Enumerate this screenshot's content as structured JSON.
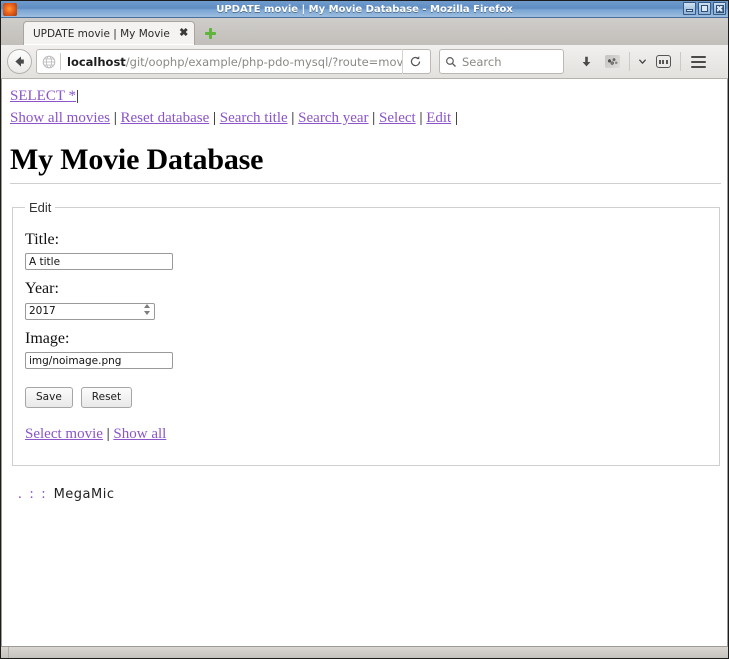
{
  "window": {
    "title": "UPDATE movie | My Movie Database - Mozilla Firefox",
    "app_icon": "firefox-icon",
    "controls": {
      "minimize": "minimize-button",
      "maximize": "maximize-button",
      "close": "close-button"
    }
  },
  "browser": {
    "tab": {
      "label": "UPDATE movie | My Movie D...",
      "close_label": "✖"
    },
    "new_tab_label": "new-tab",
    "back_label": "Back",
    "url": {
      "host": "localhost",
      "path": "/git/oophp/example/php-pdo-mysql/?route=movie-edit&"
    },
    "reload_label": "↻",
    "search": {
      "placeholder": "Search",
      "value": ""
    },
    "tools": {
      "downloads": "downloads",
      "addon": "addon",
      "chevron": "⌄",
      "reader": "reader-view",
      "menu": "open-menu"
    }
  },
  "page": {
    "top_nav": {
      "first_row": [
        {
          "label": "SELECT *",
          "href": "#"
        }
      ],
      "second_row": [
        {
          "label": "Show all movies",
          "href": "#"
        },
        {
          "label": "Reset database",
          "href": "#"
        },
        {
          "label": "Search title",
          "href": "#"
        },
        {
          "label": "Search year",
          "href": "#"
        },
        {
          "label": "Select",
          "href": "#"
        },
        {
          "label": "Edit",
          "href": "#"
        }
      ],
      "separator": "|"
    },
    "title": "My Movie Database",
    "form": {
      "legend": "Edit",
      "fields": [
        {
          "name": "title",
          "label": "Title:",
          "value": "A title",
          "type": "text"
        },
        {
          "name": "year",
          "label": "Year:",
          "value": "2017",
          "type": "number"
        },
        {
          "name": "image",
          "label": "Image:",
          "value": "img/noimage.png",
          "type": "text"
        }
      ],
      "buttons": [
        {
          "name": "save",
          "label": "Save"
        },
        {
          "name": "reset",
          "label": "Reset"
        }
      ]
    },
    "bottom_links": [
      {
        "label": "Select movie",
        "href": "#"
      },
      {
        "label": "Show all",
        "href": "#"
      }
    ],
    "bottom_separator": "|",
    "footer": {
      "dots": ". : :",
      "brand": "MegaMic"
    }
  },
  "colors": {
    "link": "#8b55c9",
    "titlebar": "#5f8dc2",
    "page_bg": "#ffffff"
  }
}
